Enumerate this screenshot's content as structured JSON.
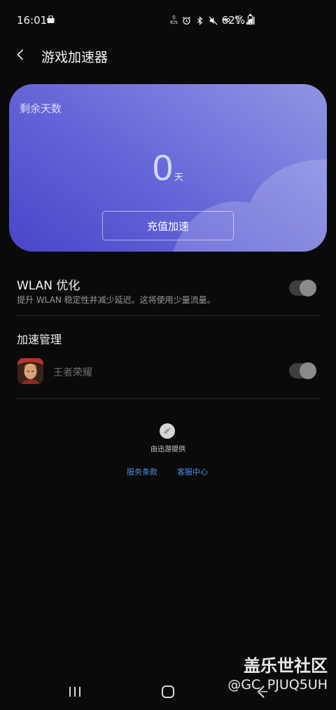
{
  "status_bar": {
    "time": "16:01",
    "net_speed_top": "0",
    "net_speed_bottom": "K/s",
    "hd": "HD",
    "network_top": "4G",
    "network_bottom": "⇅",
    "battery": "62%"
  },
  "header": {
    "title": "游戏加速器"
  },
  "card": {
    "label": "剩余天数",
    "days_value": "0",
    "days_unit": "天",
    "button_label": "充值加速"
  },
  "wlan": {
    "title": "WLAN 优化",
    "description": "提升 WLAN 稳定性并减少延迟。这将使用少量流量。",
    "enabled": true
  },
  "boost_management": {
    "title": "加速管理",
    "games": [
      {
        "name": "王者荣耀",
        "enabled": true
      }
    ]
  },
  "footer": {
    "provider": "由迅游提供",
    "terms_link": "服务条款",
    "support_link": "客服中心"
  },
  "watermark": {
    "title": "盖乐世社区",
    "user": "@GC_PJUQ5UH"
  },
  "colors": {
    "card_gradient_start": "#4a45c8",
    "card_gradient_end": "#8f96e3",
    "link": "#4a8ee8",
    "background": "#0a0a0a"
  }
}
